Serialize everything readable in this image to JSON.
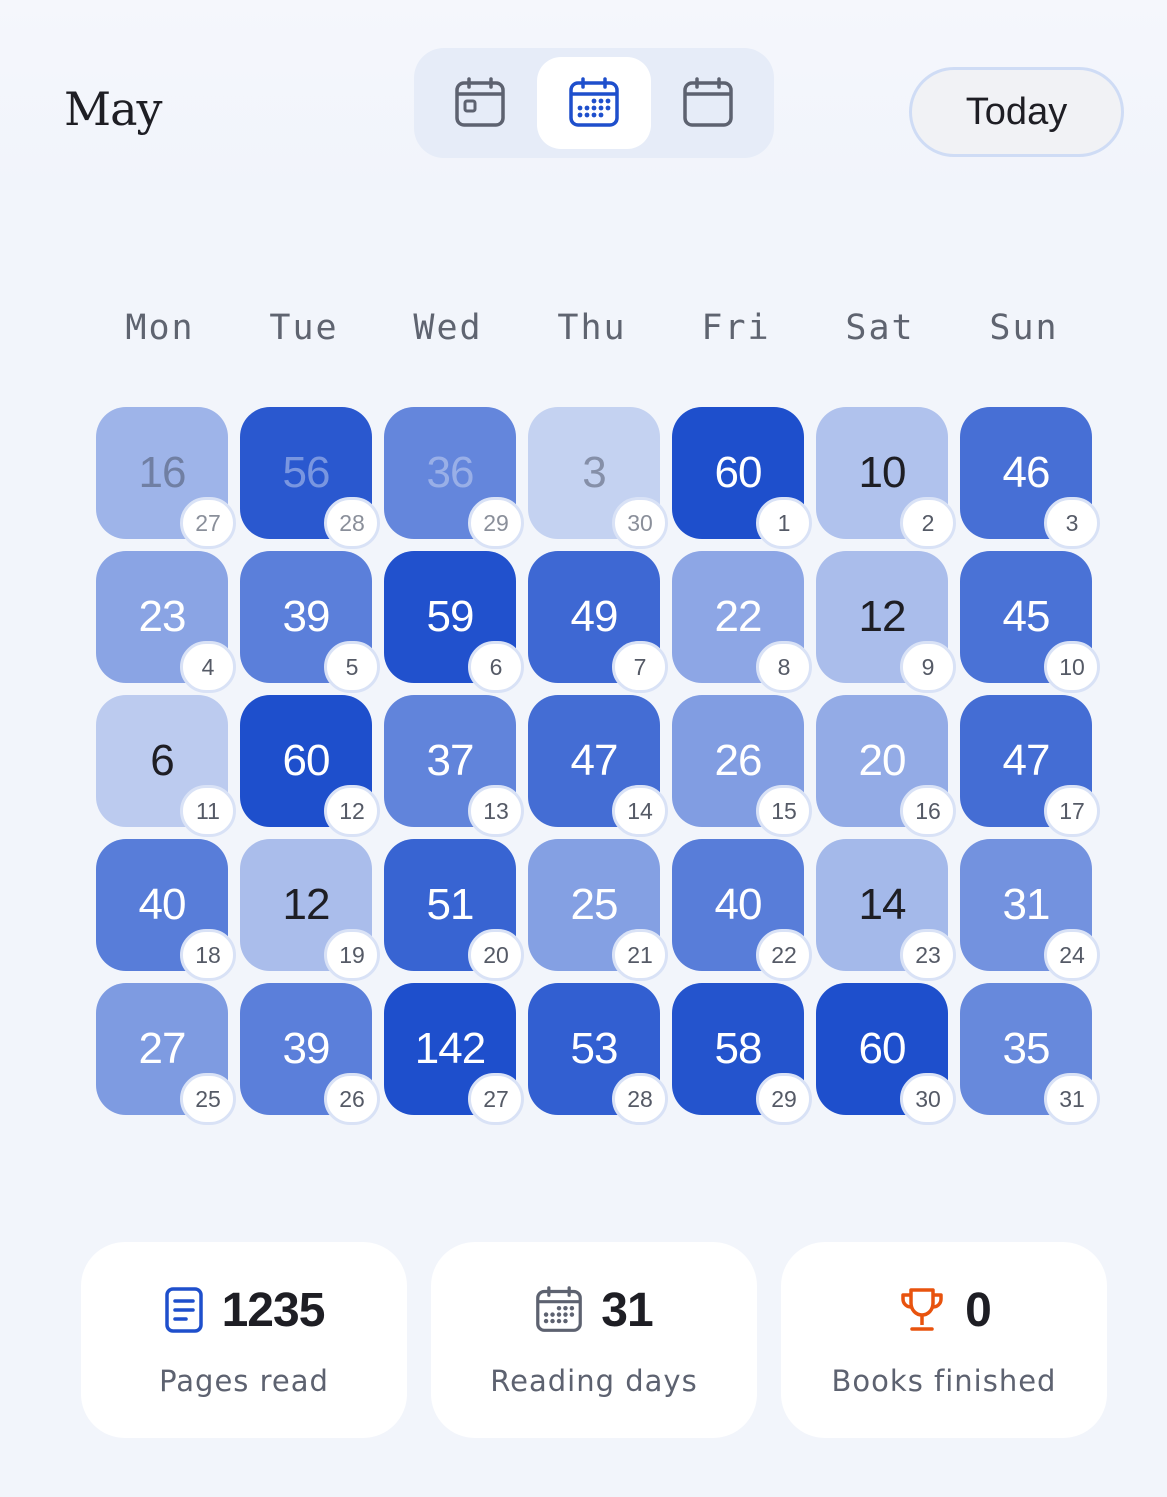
{
  "header": {
    "month": "May",
    "today_label": "Today",
    "views": [
      {
        "icon": "calendar-day-icon",
        "active": false
      },
      {
        "icon": "calendar-month-icon",
        "active": true
      },
      {
        "icon": "calendar-blank-icon",
        "active": false
      }
    ]
  },
  "weekdays": [
    "Mon",
    "Tue",
    "Wed",
    "Thu",
    "Fri",
    "Sat",
    "Sun"
  ],
  "calendar": {
    "max_pages": 60,
    "weeks": [
      [
        {
          "day": "27",
          "pages": "16",
          "current_month": false
        },
        {
          "day": "28",
          "pages": "56",
          "current_month": false
        },
        {
          "day": "29",
          "pages": "36",
          "current_month": false
        },
        {
          "day": "30",
          "pages": "3",
          "current_month": false
        },
        {
          "day": "1",
          "pages": "60",
          "current_month": true
        },
        {
          "day": "2",
          "pages": "10",
          "current_month": true
        },
        {
          "day": "3",
          "pages": "46",
          "current_month": true
        }
      ],
      [
        {
          "day": "4",
          "pages": "23",
          "current_month": true
        },
        {
          "day": "5",
          "pages": "39",
          "current_month": true
        },
        {
          "day": "6",
          "pages": "59",
          "current_month": true
        },
        {
          "day": "7",
          "pages": "49",
          "current_month": true
        },
        {
          "day": "8",
          "pages": "22",
          "current_month": true
        },
        {
          "day": "9",
          "pages": "12",
          "current_month": true
        },
        {
          "day": "10",
          "pages": "45",
          "current_month": true
        }
      ],
      [
        {
          "day": "11",
          "pages": "6",
          "current_month": true
        },
        {
          "day": "12",
          "pages": "60",
          "current_month": true
        },
        {
          "day": "13",
          "pages": "37",
          "current_month": true
        },
        {
          "day": "14",
          "pages": "47",
          "current_month": true
        },
        {
          "day": "15",
          "pages": "26",
          "current_month": true
        },
        {
          "day": "16",
          "pages": "20",
          "current_month": true
        },
        {
          "day": "17",
          "pages": "47",
          "current_month": true
        }
      ],
      [
        {
          "day": "18",
          "pages": "40",
          "current_month": true
        },
        {
          "day": "19",
          "pages": "12",
          "current_month": true
        },
        {
          "day": "20",
          "pages": "51",
          "current_month": true
        },
        {
          "day": "21",
          "pages": "25",
          "current_month": true
        },
        {
          "day": "22",
          "pages": "40",
          "current_month": true
        },
        {
          "day": "23",
          "pages": "14",
          "current_month": true
        },
        {
          "day": "24",
          "pages": "31",
          "current_month": true
        }
      ],
      [
        {
          "day": "25",
          "pages": "27",
          "current_month": true
        },
        {
          "day": "26",
          "pages": "39",
          "current_month": true
        },
        {
          "day": "27",
          "pages": "142",
          "current_month": true
        },
        {
          "day": "28",
          "pages": "53",
          "current_month": true
        },
        {
          "day": "29",
          "pages": "58",
          "current_month": true
        },
        {
          "day": "30",
          "pages": "60",
          "current_month": true
        },
        {
          "day": "31",
          "pages": "35",
          "current_month": true
        }
      ]
    ]
  },
  "stats": [
    {
      "icon": "document-icon",
      "value": "1235",
      "label": "Pages read",
      "color": "#1e4fcc"
    },
    {
      "icon": "calendar-icon",
      "value": "31",
      "label": "Reading days",
      "color": "#5d6270"
    },
    {
      "icon": "trophy-icon",
      "value": "0",
      "label": "Books finished",
      "color": "#e8530e"
    }
  ],
  "colors": {
    "accent": "#1e4fcc",
    "text": "#1e1e24"
  }
}
